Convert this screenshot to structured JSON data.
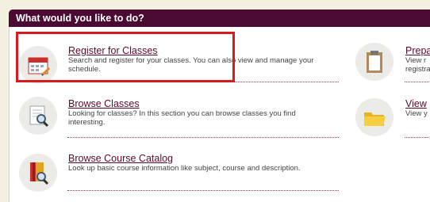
{
  "header": {
    "title": "What would you like to do?"
  },
  "items": [
    {
      "title": "Register for Classes",
      "description": "Search and register for your classes. You can also view and manage your schedule.",
      "icon": "calendar-icon"
    },
    {
      "title": "Browse Classes",
      "description": "Looking for classes? In this section you can browse classes you find interesting.",
      "icon": "document-search-icon"
    },
    {
      "title": "Browse Course Catalog",
      "description": "Look up basic course information like subject, course and description.",
      "icon": "book-search-icon"
    },
    {
      "title": "Prepa",
      "description": "View r registra",
      "icon": "clipboard-icon"
    },
    {
      "title": "View",
      "description": "View y",
      "icon": "folder-icon"
    }
  ],
  "colors": {
    "header_bg": "#4a0a32",
    "link": "#5a0a2d",
    "highlight": "#d8191f"
  }
}
